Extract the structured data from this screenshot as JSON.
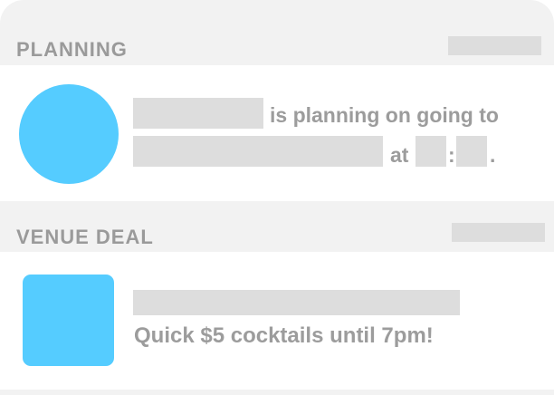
{
  "colors": {
    "accent": "#55ccff",
    "header_text": "#9a9a9a",
    "body_text": "#9c9c9c",
    "placeholder": "#dddddd",
    "divider": "#f2f2f2"
  },
  "planning": {
    "title": "PLANNING",
    "avatar_icon": "user-avatar-circle",
    "message_prefix": "is planning on going to",
    "at_label": "at",
    "time_separator": ":",
    "period": "."
  },
  "venue_deal": {
    "title": "VENUE DEAL",
    "thumbnail_icon": "venue-thumbnail",
    "message": "Quick $5 cocktails until 7pm!"
  }
}
